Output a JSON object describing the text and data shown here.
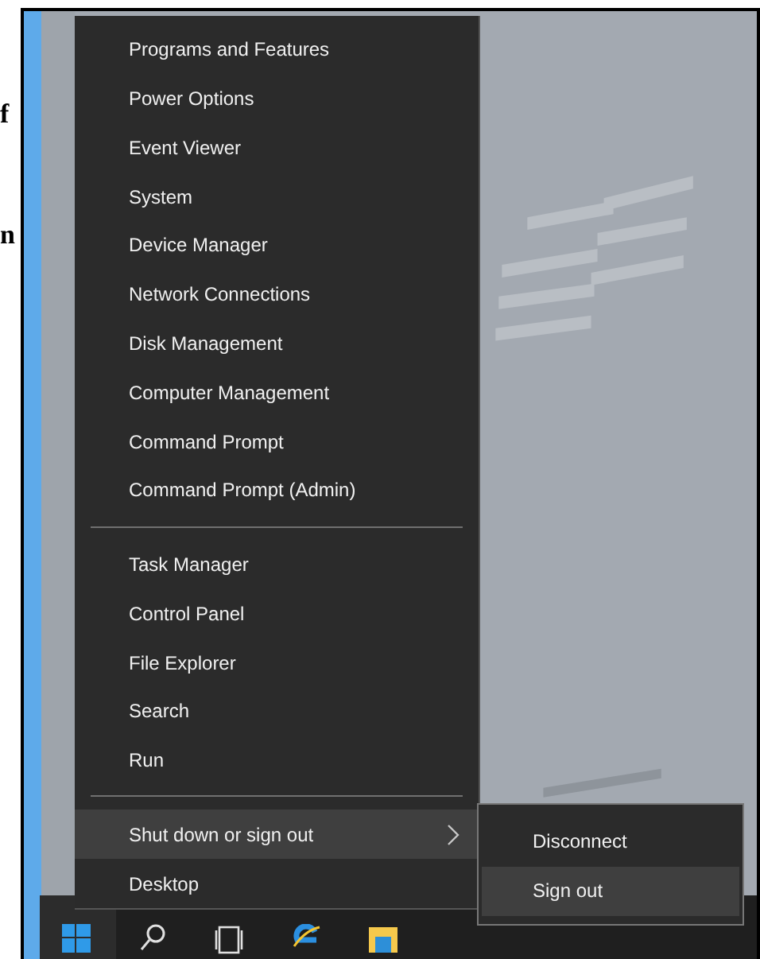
{
  "page_text": [
    {
      "text": "f"
    },
    {
      "text": "n"
    }
  ],
  "menu": {
    "items": [
      {
        "kind": "item",
        "label": "Programs and Features",
        "selected": false
      },
      {
        "kind": "item",
        "label": "Power Options",
        "selected": false
      },
      {
        "kind": "item",
        "label": "Event Viewer",
        "selected": false
      },
      {
        "kind": "item",
        "label": "System",
        "selected": false
      },
      {
        "kind": "item",
        "label": "Device Manager",
        "selected": false
      },
      {
        "kind": "item",
        "label": "Network Connections",
        "selected": false
      },
      {
        "kind": "item",
        "label": "Disk Management",
        "selected": false
      },
      {
        "kind": "item",
        "label": "Computer Management",
        "selected": false
      },
      {
        "kind": "item",
        "label": "Command Prompt",
        "selected": false
      },
      {
        "kind": "item",
        "label": "Command Prompt (Admin)",
        "selected": false
      },
      {
        "kind": "separator"
      },
      {
        "kind": "item",
        "label": "Task Manager",
        "selected": false
      },
      {
        "kind": "item",
        "label": "Control Panel",
        "selected": false
      },
      {
        "kind": "item",
        "label": "File Explorer",
        "selected": false
      },
      {
        "kind": "item",
        "label": "Search",
        "selected": false
      },
      {
        "kind": "item",
        "label": "Run",
        "selected": false
      },
      {
        "kind": "separator"
      },
      {
        "kind": "submenu",
        "label": "Shut down or sign out",
        "selected": true
      },
      {
        "kind": "item",
        "label": "Desktop",
        "selected": false
      }
    ]
  },
  "submenu": {
    "items": [
      {
        "label": "Disconnect",
        "selected": false
      },
      {
        "label": "Sign out",
        "selected": true
      }
    ]
  },
  "taskbar": {
    "icons": [
      {
        "kind": "start"
      },
      {
        "kind": "search"
      },
      {
        "kind": "taskview"
      },
      {
        "kind": "browser"
      },
      {
        "kind": "folder"
      }
    ]
  }
}
